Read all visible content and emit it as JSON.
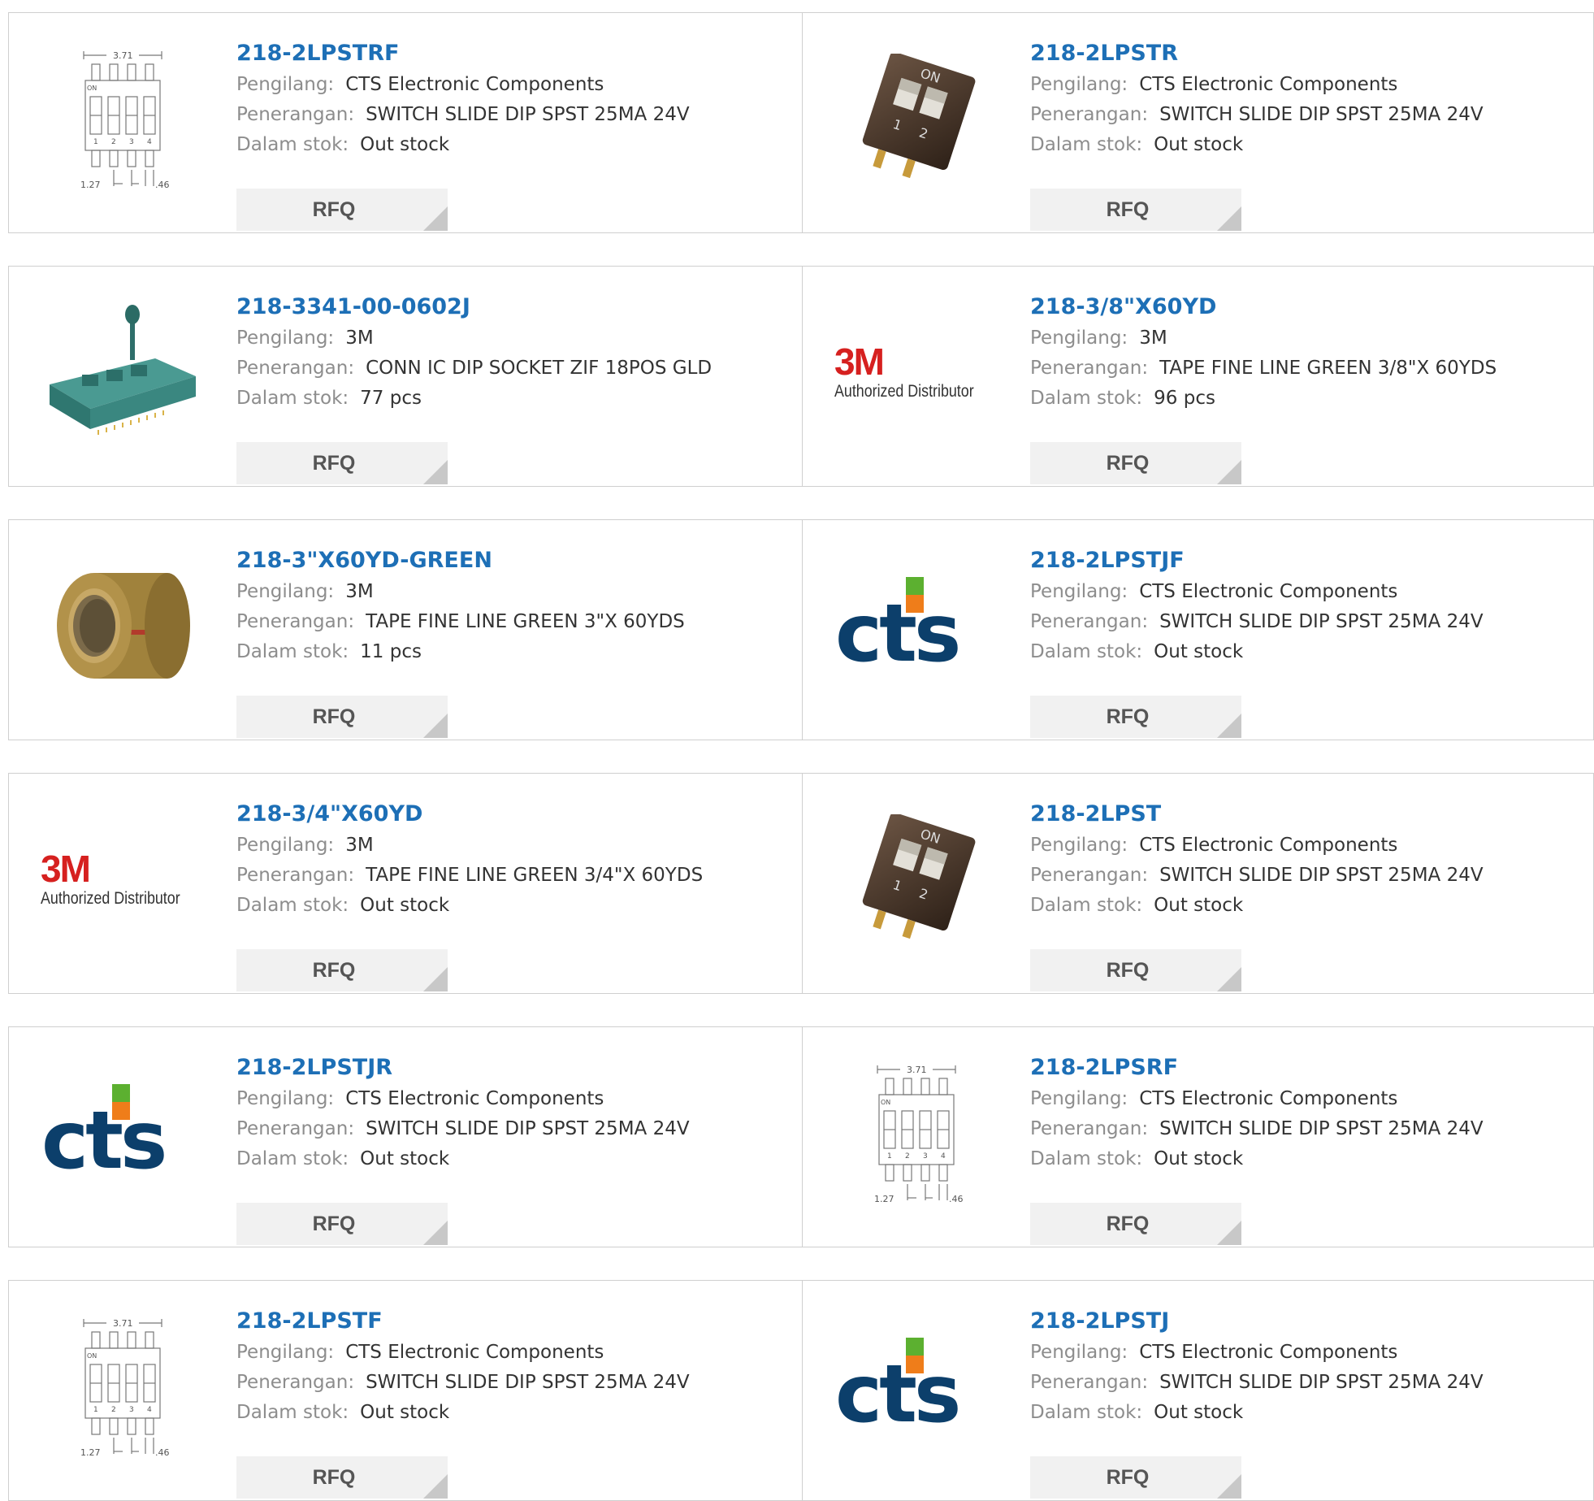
{
  "labels": {
    "manufacturer": "Pengilang:",
    "description": "Penerangan:",
    "stock": "Dalam stok:",
    "rfq": "RFQ"
  },
  "schematic_text": {
    "width": "3.71",
    "on": "ON",
    "pin1": "1",
    "pin2": "2",
    "pin3": "3",
    "pin4": "4",
    "pitch": "1.27",
    "lead": ".46"
  },
  "logos": {
    "m3_mark": "3M",
    "m3_authorized": "Authorized Distributor",
    "cts_mark": "cts"
  },
  "products": [
    {
      "part": "218-2LPSTRF",
      "manufacturer": "CTS Electronic Components",
      "description": "SWITCH SLIDE DIP SPST 25MA 24V",
      "stock": "Out stock",
      "image": "dip-schematic-icon"
    },
    {
      "part": "218-2LPSTR",
      "manufacturer": "CTS Electronic Components",
      "description": "SWITCH SLIDE DIP SPST 25MA 24V",
      "stock": "Out stock",
      "image": "dip-switch-photo"
    },
    {
      "part": "218-3341-00-0602J",
      "manufacturer": "3M",
      "description": "CONN IC DIP SOCKET ZIF 18POS GLD",
      "stock": "77 pcs",
      "image": "zif-socket-photo"
    },
    {
      "part": "218-3/8\"X60YD",
      "manufacturer": "3M",
      "description": "TAPE FINE LINE GREEN 3/8\"X 60YDS",
      "stock": "96 pcs",
      "image": "3m-logo"
    },
    {
      "part": "218-3\"X60YD-GREEN",
      "manufacturer": "3M",
      "description": "TAPE FINE LINE GREEN 3\"X 60YDS",
      "stock": "11 pcs",
      "image": "tape-roll-photo"
    },
    {
      "part": "218-2LPSTJF",
      "manufacturer": "CTS Electronic Components",
      "description": "SWITCH SLIDE DIP SPST 25MA 24V",
      "stock": "Out stock",
      "image": "cts-logo"
    },
    {
      "part": "218-3/4\"X60YD",
      "manufacturer": "3M",
      "description": "TAPE FINE LINE GREEN 3/4\"X 60YDS",
      "stock": "Out stock",
      "image": "3m-logo"
    },
    {
      "part": "218-2LPST",
      "manufacturer": "CTS Electronic Components",
      "description": "SWITCH SLIDE DIP SPST 25MA 24V",
      "stock": "Out stock",
      "image": "dip-switch-photo"
    },
    {
      "part": "218-2LPSTJR",
      "manufacturer": "CTS Electronic Components",
      "description": "SWITCH SLIDE DIP SPST 25MA 24V",
      "stock": "Out stock",
      "image": "cts-logo"
    },
    {
      "part": "218-2LPSRF",
      "manufacturer": "CTS Electronic Components",
      "description": "SWITCH SLIDE DIP SPST 25MA 24V",
      "stock": "Out stock",
      "image": "dip-schematic-icon"
    },
    {
      "part": "218-2LPSTF",
      "manufacturer": "CTS Electronic Components",
      "description": "SWITCH SLIDE DIP SPST 25MA 24V",
      "stock": "Out stock",
      "image": "dip-schematic-icon"
    },
    {
      "part": "218-2LPSTJ",
      "manufacturer": "CTS Electronic Components",
      "description": "SWITCH SLIDE DIP SPST 25MA 24V",
      "stock": "Out stock",
      "image": "cts-logo"
    }
  ],
  "colors": {
    "part_link": "#1d6fb6",
    "label_gray": "#8d8d8d",
    "value_text": "#333333",
    "rfq_bg": "#f1f1f1",
    "border": "#cfcfcf",
    "m3_red": "#d6201f",
    "cts_navy": "#0c3f6b",
    "cts_green": "#5cb030",
    "cts_orange": "#ef7d1a"
  }
}
